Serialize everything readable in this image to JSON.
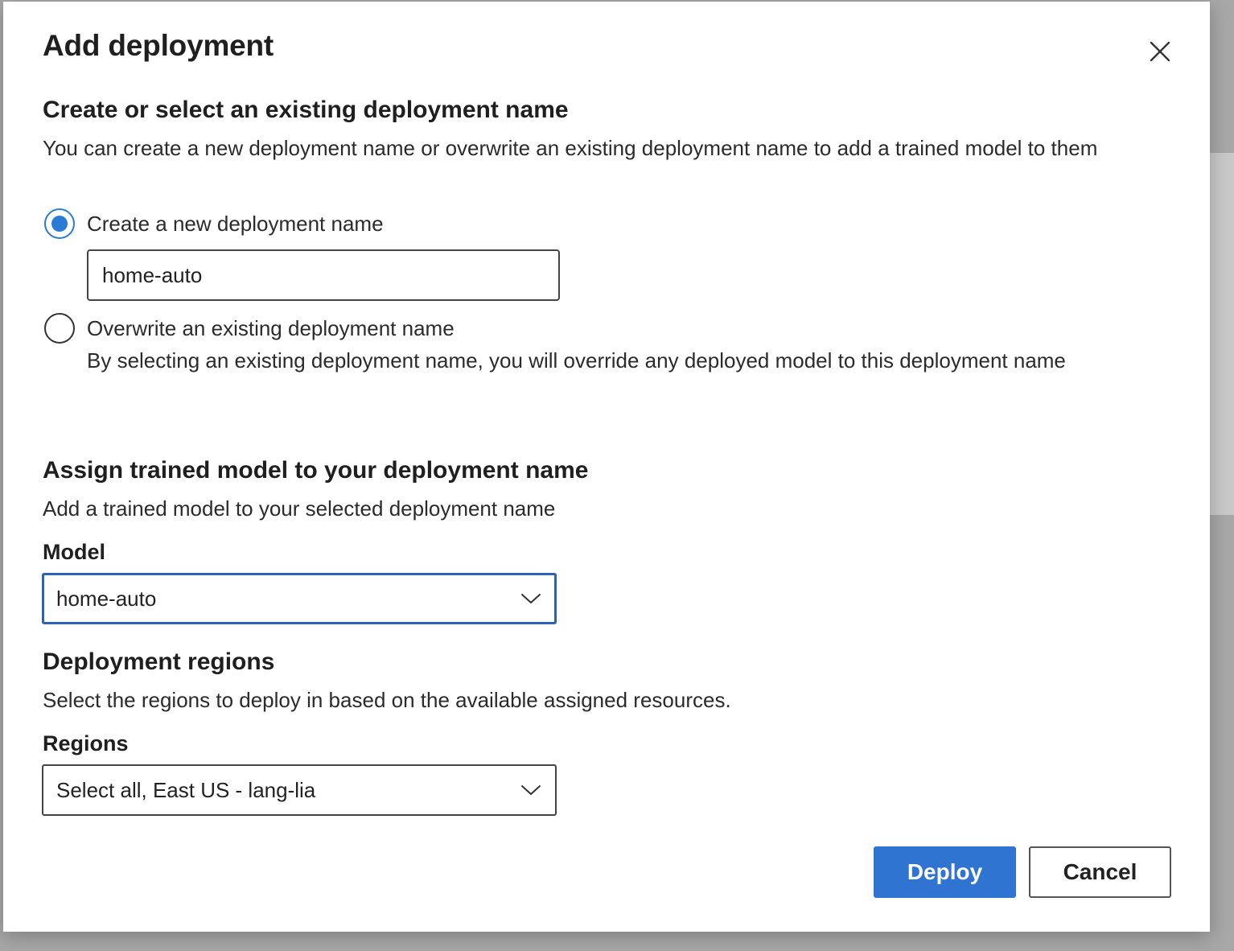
{
  "dialog": {
    "title": "Add deployment",
    "close_label": "Close"
  },
  "deployment_name": {
    "heading": "Create or select an existing deployment name",
    "description": "You can create a new deployment name or overwrite an existing deployment name to add a trained model to them",
    "option_create": {
      "label": "Create a new deployment name",
      "selected": true,
      "input_value": "home-auto"
    },
    "option_overwrite": {
      "label": "Overwrite an existing deployment name",
      "selected": false,
      "description": "By selecting an existing deployment name, you will override any deployed model to this deployment name"
    }
  },
  "assign_model": {
    "heading": "Assign trained model to your deployment name",
    "description": "Add a trained model to your selected deployment name",
    "model_label": "Model",
    "model_value": "home-auto"
  },
  "regions": {
    "heading": "Deployment regions",
    "description": "Select the regions to deploy in based on the available assigned resources.",
    "regions_label": "Regions",
    "regions_value": "Select all, East US - lang-lia"
  },
  "actions": {
    "deploy_label": "Deploy",
    "cancel_label": "Cancel"
  },
  "colors": {
    "accent": "#2f74d0",
    "radio_selected": "#2b7bd6",
    "focus_border": "#2b62b8"
  },
  "icons": {
    "close": "close-icon",
    "dropdown": "chevron-down-icon"
  }
}
